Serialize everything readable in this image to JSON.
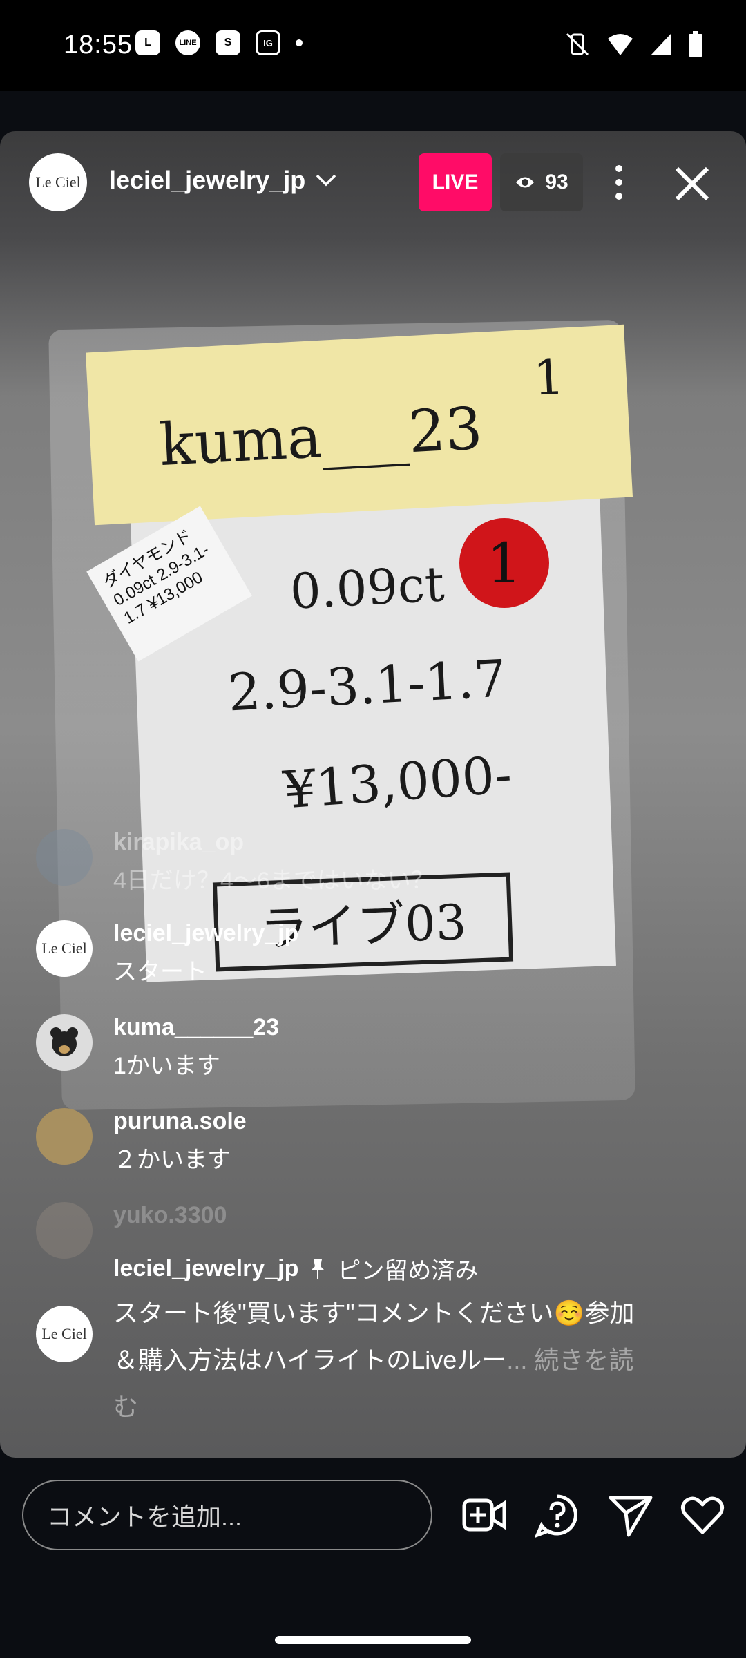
{
  "status_bar": {
    "time": "18:55",
    "apps": [
      "L",
      "LINE",
      "S",
      "IG"
    ]
  },
  "header": {
    "host_username": "leciel_jewelry_jp",
    "host_avatar_text": "Le Ciel",
    "live_label": "LIVE",
    "viewer_count": "93"
  },
  "scene": {
    "note_text": "kuma___23",
    "note_number": "1",
    "sticker_number": "1",
    "tag_text": "ダイヤモンド 0.09ct 2.9-3.1-1.7 ¥13,000",
    "line1": "0.09ct",
    "line2": "2.9-3.1-1.7",
    "line3": "¥13,000-",
    "line4": "ライブ03"
  },
  "comments": [
    {
      "user": "kirapika_op",
      "text": "4日だけ？4〜6まではいない？"
    },
    {
      "user": "leciel_jewelry_jp",
      "text": "スタート"
    },
    {
      "user": "kuma______23",
      "text": "1かいます"
    },
    {
      "user": "puruna.sole",
      "text": "２かいます"
    },
    {
      "user": "yuko.3300",
      "text": ""
    }
  ],
  "pinned": {
    "user": "leciel_jewelry_jp",
    "label": "ピン留め済み",
    "text": "スタート後\"買います\"コメントください☺️参加＆購入方法はハイライトのLiveルー",
    "read_more": "... 続きを読む"
  },
  "bottom_bar": {
    "comment_placeholder": "コメントを追加..."
  },
  "colors": {
    "live_badge": "#ff0c67",
    "background": "#0b0d12"
  }
}
